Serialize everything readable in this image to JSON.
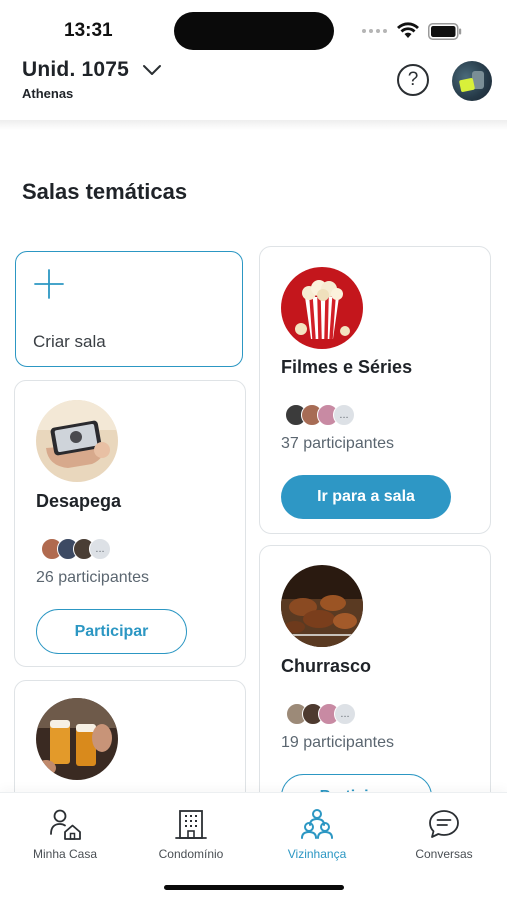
{
  "status_bar": {
    "time": "13:31"
  },
  "header": {
    "unit_title": "Unid. 1075",
    "unit_subtitle": "Athenas",
    "help_label": "?"
  },
  "section": {
    "title": "Salas temáticas"
  },
  "create_room": {
    "label": "Criar sala"
  },
  "rooms": [
    {
      "name": "Filmes e Séries",
      "participants": "37 participantes",
      "action": "Ir para a sala",
      "action_style": "filled",
      "more": "..."
    },
    {
      "name": "Desapega",
      "participants": "26 participantes",
      "action": "Participar",
      "action_style": "outline",
      "more": "..."
    },
    {
      "name": "Churrasco",
      "participants": "19 participantes",
      "action": "Participar",
      "action_style": "outline",
      "more": "..."
    }
  ],
  "bottom_nav": {
    "items": [
      {
        "label": "Minha Casa",
        "icon": "person-home-icon",
        "active": false
      },
      {
        "label": "Condomínio",
        "icon": "building-icon",
        "active": false
      },
      {
        "label": "Vizinhança",
        "icon": "neighbors-icon",
        "active": true
      },
      {
        "label": "Conversas",
        "icon": "chat-bubble-icon",
        "active": false
      }
    ]
  },
  "colors": {
    "accent": "#2c97c3",
    "text": "#1f2328",
    "muted": "#5b6670",
    "card_border": "#dfe3e6"
  }
}
